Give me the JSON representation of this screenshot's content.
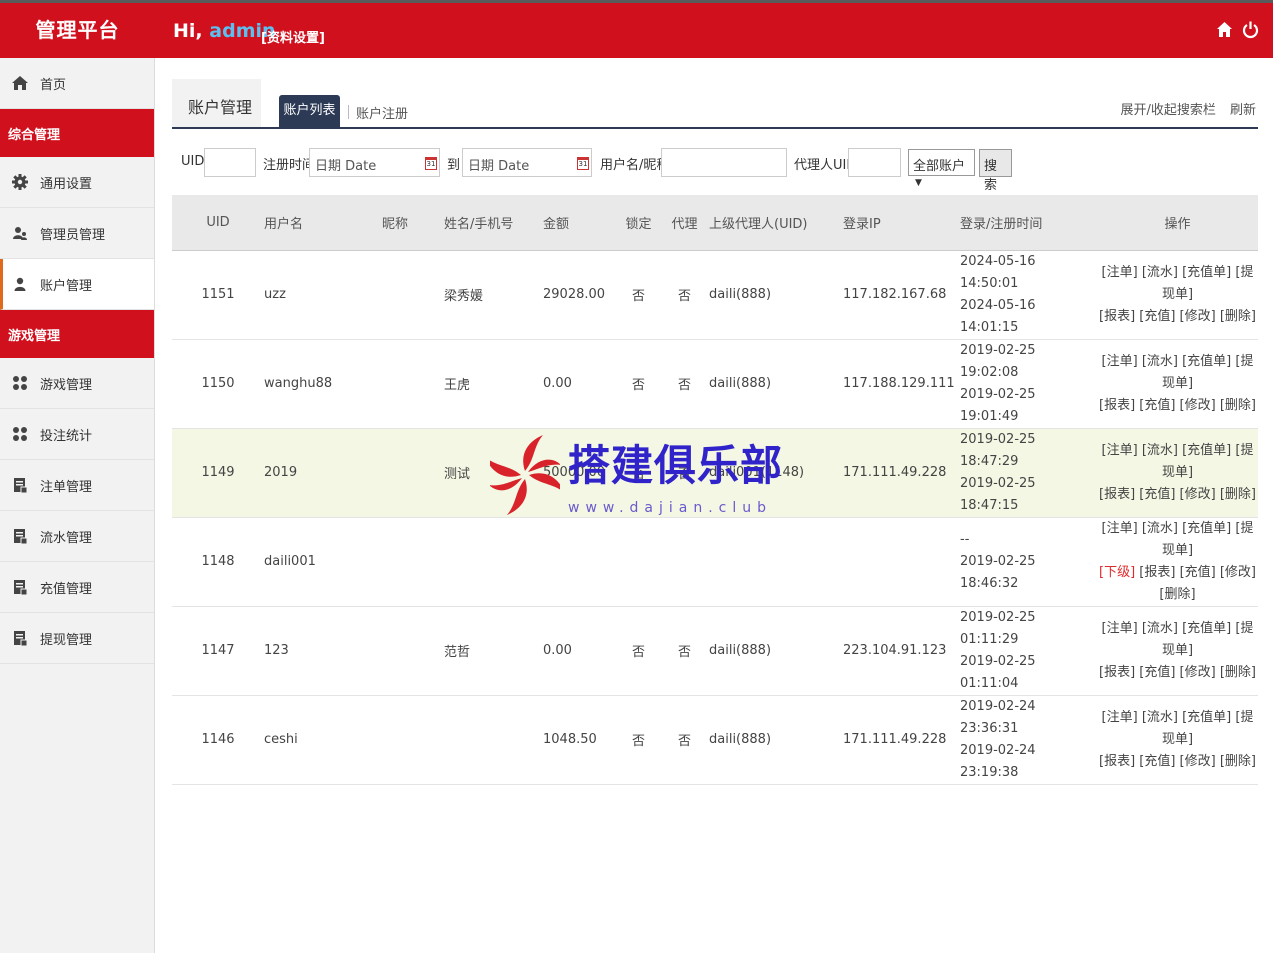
{
  "header": {
    "brand": "管理平台",
    "greeting": "Hi,",
    "username": "admin",
    "profile_link": "[资料设置]",
    "icons": [
      "home-icon",
      "power-icon"
    ]
  },
  "sidebar": {
    "home": "首页",
    "group1": "综合管理",
    "general_settings": "通用设置",
    "admin_manage": "管理员管理",
    "account_manage": "账户管理",
    "group2": "游戏管理",
    "game_manage": "游戏管理",
    "bet_stats": "投注统计",
    "order_manage": "注单管理",
    "flow_manage": "流水管理",
    "recharge_manage": "充值管理",
    "withdraw_manage": "提现管理"
  },
  "panel": {
    "title": "账户管理",
    "tab_list": "账户列表",
    "tab_register": "账户注册",
    "toggle_search": "展开/收起搜索栏",
    "refresh": "刷新"
  },
  "search": {
    "uid_label": "UID",
    "reg_time_label": "注册时间",
    "date_placeholder_1": "日期 Date",
    "to_label": "到",
    "date_placeholder_2": "日期 Date",
    "calendar_day": "31",
    "username_label": "用户名/昵称",
    "agent_uid_label": "代理人UID",
    "account_select": "全部账户",
    "search_button": "搜索"
  },
  "table": {
    "headers": {
      "uid": "UID",
      "username": "用户名",
      "nickname": "昵称",
      "name_phone": "姓名/手机号",
      "amount": "金额",
      "locked": "锁定",
      "agent": "代理",
      "parent_agent": "上级代理人(UID)",
      "login_ip": "登录IP",
      "times": "登录/注册时间",
      "ops": "操作"
    },
    "rows": [
      {
        "uid": "1151",
        "username": "uzz",
        "nickname": "",
        "name": "梁秀媛",
        "amount": "29028.00",
        "locked": "否",
        "agent": "否",
        "parent": "daili(888)",
        "ip": "117.182.167.68",
        "login": "2024-05-16 14:50:01",
        "reg": "2024-05-16 14:01:15",
        "sub": "",
        "ops1": "[注单] [流水] [充值单] [提现单]",
        "ops2": "[报表] [充值] [修改] [删除]"
      },
      {
        "uid": "1150",
        "username": "wanghu88",
        "nickname": "",
        "name": "王虎",
        "amount": "0.00",
        "locked": "否",
        "agent": "否",
        "parent": "daili(888)",
        "ip": "117.188.129.111",
        "login": "2019-02-25 19:02:08",
        "reg": "2019-02-25 19:01:49",
        "sub": "",
        "ops1": "[注单] [流水] [充值单] [提现单]",
        "ops2": "[报表] [充值] [修改] [删除]"
      },
      {
        "uid": "1149",
        "username": "2019",
        "nickname": "",
        "name": "测试",
        "amount": "50000.00",
        "locked": "否",
        "agent": "否",
        "parent": "daili001(1148)",
        "ip": "171.111.49.228",
        "login": "2019-02-25 18:47:29",
        "reg": "2019-02-25 18:47:15",
        "sub": "",
        "ops1": "[注单] [流水] [充值单] [提现单]",
        "ops2": "[报表] [充值] [修改] [删除]"
      },
      {
        "uid": "1148",
        "username": "daili001",
        "nickname": "",
        "name": "",
        "amount": "",
        "locked": "",
        "agent": "",
        "parent": "",
        "ip": "",
        "login": "--",
        "reg": "2019-02-25 18:46:32",
        "sub": "[下级]",
        "ops1": "[注单] [流水] [充值单] [提现单]",
        "ops2": "[报表] [充值] [修改] [删除]"
      },
      {
        "uid": "1147",
        "username": "123",
        "nickname": "",
        "name": "范哲",
        "amount": "0.00",
        "locked": "否",
        "agent": "否",
        "parent": "daili(888)",
        "ip": "223.104.91.123",
        "login": "2019-02-25 01:11:29",
        "reg": "2019-02-25 01:11:04",
        "sub": "",
        "ops1": "[注单] [流水] [充值单] [提现单]",
        "ops2": "[报表] [充值] [修改] [删除]"
      },
      {
        "uid": "1146",
        "username": "ceshi",
        "nickname": "",
        "name": "",
        "amount": "1048.50",
        "locked": "否",
        "agent": "否",
        "parent": "daili(888)",
        "ip": "171.111.49.228",
        "login": "2019-02-24 23:36:31",
        "reg": "2019-02-24 23:19:38",
        "sub": "",
        "ops1": "[注单] [流水] [充值单] [提现单]",
        "ops2": "[报表] [充值] [修改] [删除]"
      }
    ]
  },
  "watermark": {
    "text": "搭建俱乐部",
    "sub": "www.dajian.club"
  },
  "colors": {
    "brand_red": "#d1101e",
    "tab_navy": "#2c3a55",
    "highlight_row": "#f3f7e4",
    "sidebar_accent": "#e06a1b"
  }
}
